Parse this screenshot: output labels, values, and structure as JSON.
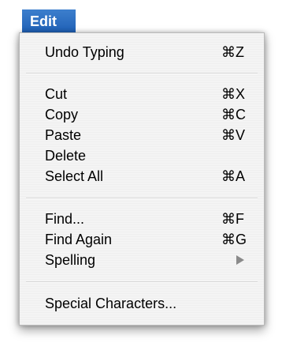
{
  "menubar": {
    "title": "Edit"
  },
  "menu": {
    "items": [
      {
        "label": "Undo Typing",
        "shortcut": "⌘Z"
      },
      {
        "label": "Cut",
        "shortcut": "⌘X"
      },
      {
        "label": "Copy",
        "shortcut": "⌘C"
      },
      {
        "label": "Paste",
        "shortcut": "⌘V"
      },
      {
        "label": "Delete",
        "shortcut": ""
      },
      {
        "label": "Select All",
        "shortcut": "⌘A"
      },
      {
        "label": "Find...",
        "shortcut": "⌘F"
      },
      {
        "label": "Find Again",
        "shortcut": "⌘G"
      },
      {
        "label": "Spelling",
        "submenu_icon": "submenu-arrow-icon"
      },
      {
        "label": "Special Characters...",
        "shortcut": ""
      }
    ]
  },
  "colors": {
    "menu_title_bg": "#2a6ec1",
    "menu_bg": "#f4f4f4",
    "separator": "#d6d6d6"
  }
}
